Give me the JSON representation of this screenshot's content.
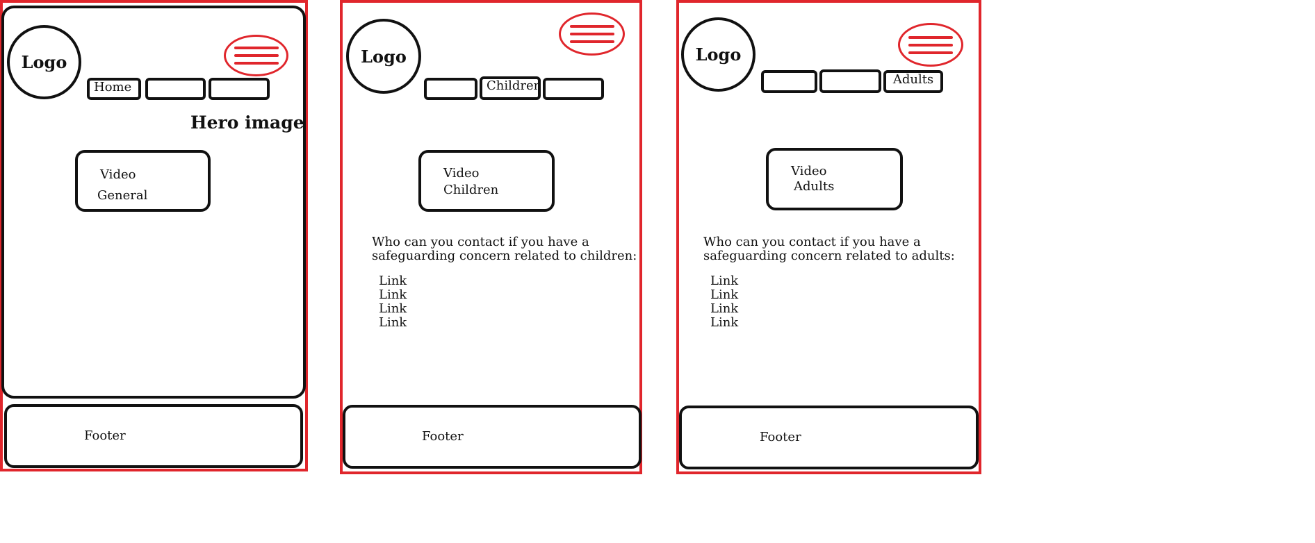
{
  "colors": {
    "frame": "#e0262c",
    "outline": "#111111",
    "menu": "#e0262c"
  },
  "icons": {
    "menu": "hamburger-menu-icon"
  },
  "screens": [
    {
      "logo": "Logo",
      "tabs": [
        "Home",
        "",
        ""
      ],
      "hero": "Hero image",
      "video": {
        "line1": "Video",
        "line2": "General"
      },
      "footer": "Footer"
    },
    {
      "logo": "Logo",
      "tabs": [
        "",
        "Children",
        ""
      ],
      "video": {
        "line1": "Video",
        "line2": "Children"
      },
      "contact": {
        "line1": "Who can you contact if you have a",
        "line2": "safeguarding concern related to children:"
      },
      "links": [
        "Link",
        "Link",
        "Link",
        "Link"
      ],
      "footer": "Footer"
    },
    {
      "logo": "Logo",
      "tabs": [
        "",
        "",
        "Adults"
      ],
      "video": {
        "line1": "Video",
        "line2": "Adults"
      },
      "contact": {
        "line1": "Who can you contact if you have a",
        "line2": "safeguarding concern related to adults:"
      },
      "links": [
        "Link",
        "Link",
        "Link",
        "Link"
      ],
      "footer": "Footer"
    }
  ]
}
